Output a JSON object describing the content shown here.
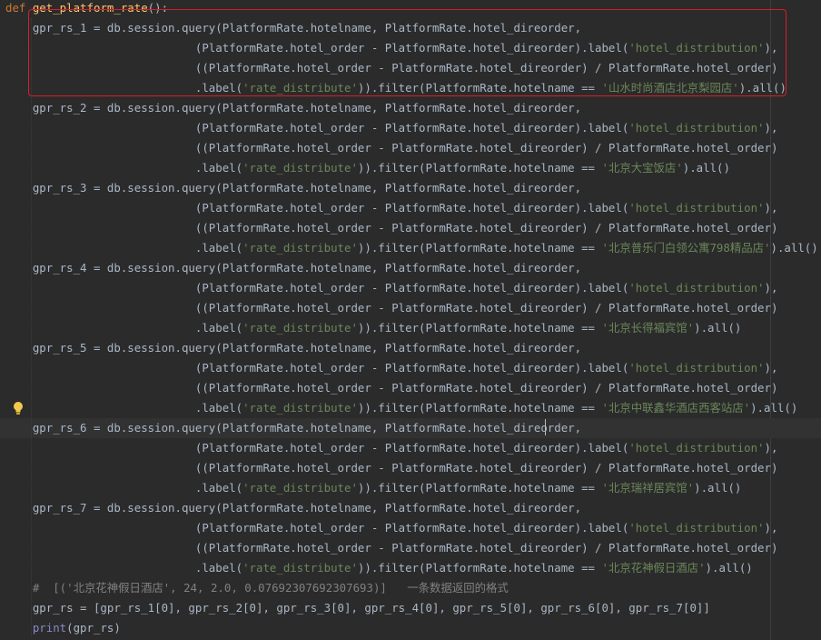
{
  "colors": {
    "background": "#2b2b2b",
    "text": "#a9b7c6",
    "keyword": "#cc7832",
    "function_name": "#ffc66d",
    "string": "#6a8759",
    "comment": "#808080",
    "builtin": "#8888c6",
    "annotation_box": "#d81e27",
    "bulb": "#f2c94c"
  },
  "icons": {
    "bulb": "lightbulb-icon"
  },
  "lines": [
    [
      [
        "kw",
        "def "
      ],
      [
        "fn",
        "get_platform_rate"
      ],
      [
        "txt",
        "():"
      ]
    ],
    [
      [
        "txt",
        "    gpr_rs_1 = db.session.query(PlatformRate.hotelname, PlatformRate.hotel_direorder,"
      ]
    ],
    [
      [
        "txt",
        "                            (PlatformRate.hotel_order - PlatformRate.hotel_direorder).label("
      ],
      [
        "str",
        "'hotel_distribution'"
      ],
      [
        "txt",
        "),"
      ]
    ],
    [
      [
        "txt",
        "                            ((PlatformRate.hotel_order - PlatformRate.hotel_direorder) / PlatformRate.hotel_order)"
      ]
    ],
    [
      [
        "txt",
        "                            .label("
      ],
      [
        "str",
        "'rate_distribute'"
      ],
      [
        "txt",
        ")).filter(PlatformRate.hotelname == "
      ],
      [
        "str",
        "'山水时尚酒店北京梨园店'"
      ],
      [
        "txt",
        ").all()"
      ]
    ],
    [
      [
        "txt",
        "    gpr_rs_2 = db.session.query(PlatformRate.hotelname, PlatformRate.hotel_direorder,"
      ]
    ],
    [
      [
        "txt",
        "                            (PlatformRate.hotel_order - PlatformRate.hotel_direorder).label("
      ],
      [
        "str",
        "'hotel_distribution'"
      ],
      [
        "txt",
        "),"
      ]
    ],
    [
      [
        "txt",
        "                            ((PlatformRate.hotel_order - PlatformRate.hotel_direorder) / PlatformRate.hotel_order)"
      ]
    ],
    [
      [
        "txt",
        "                            .label("
      ],
      [
        "str",
        "'rate_distribute'"
      ],
      [
        "txt",
        ")).filter(PlatformRate.hotelname == "
      ],
      [
        "str",
        "'北京大宝饭店'"
      ],
      [
        "txt",
        ").all()"
      ]
    ],
    [
      [
        "txt",
        "    gpr_rs_3 = db.session.query(PlatformRate.hotelname, PlatformRate.hotel_direorder,"
      ]
    ],
    [
      [
        "txt",
        "                            (PlatformRate.hotel_order - PlatformRate.hotel_direorder).label("
      ],
      [
        "str",
        "'hotel_distribution'"
      ],
      [
        "txt",
        "),"
      ]
    ],
    [
      [
        "txt",
        "                            ((PlatformRate.hotel_order - PlatformRate.hotel_direorder) / PlatformRate.hotel_order)"
      ]
    ],
    [
      [
        "txt",
        "                            .label("
      ],
      [
        "str",
        "'rate_distribute'"
      ],
      [
        "txt",
        ")).filter(PlatformRate.hotelname == "
      ],
      [
        "str",
        "'北京普乐门白领公寓798精品店'"
      ],
      [
        "txt",
        ").all()"
      ]
    ],
    [
      [
        "txt",
        "    gpr_rs_4 = db.session.query(PlatformRate.hotelname, PlatformRate.hotel_direorder,"
      ]
    ],
    [
      [
        "txt",
        "                            (PlatformRate.hotel_order - PlatformRate.hotel_direorder).label("
      ],
      [
        "str",
        "'hotel_distribution'"
      ],
      [
        "txt",
        "),"
      ]
    ],
    [
      [
        "txt",
        "                            ((PlatformRate.hotel_order - PlatformRate.hotel_direorder) / PlatformRate.hotel_order)"
      ]
    ],
    [
      [
        "txt",
        "                            .label("
      ],
      [
        "str",
        "'rate_distribute'"
      ],
      [
        "txt",
        ")).filter(PlatformRate.hotelname == "
      ],
      [
        "str",
        "'北京长得福宾馆'"
      ],
      [
        "txt",
        ").all()"
      ]
    ],
    [
      [
        "txt",
        "    gpr_rs_5 = db.session.query(PlatformRate.hotelname, PlatformRate.hotel_direorder,"
      ]
    ],
    [
      [
        "txt",
        "                            (PlatformRate.hotel_order - PlatformRate.hotel_direorder).label("
      ],
      [
        "str",
        "'hotel_distribution'"
      ],
      [
        "txt",
        "),"
      ]
    ],
    [
      [
        "txt",
        "                            ((PlatformRate.hotel_order - PlatformRate.hotel_direorder) / PlatformRate.hotel_order)"
      ]
    ],
    [
      [
        "txt",
        "                            .label("
      ],
      [
        "str",
        "'rate_distribute'"
      ],
      [
        "txt",
        ")).filter(PlatformRate.hotelname == "
      ],
      [
        "str",
        "'北京中联鑫华酒店西客站店'"
      ],
      [
        "txt",
        ").all()"
      ]
    ],
    [
      [
        "txt",
        "    gpr_rs_6 = db.session.query(PlatformRate.hotelname, PlatformRate.hotel_direorder,"
      ]
    ],
    [
      [
        "txt",
        "                            (PlatformRate.hotel_order - PlatformRate.hotel_direorder).label("
      ],
      [
        "str",
        "'hotel_distribution'"
      ],
      [
        "txt",
        "),"
      ]
    ],
    [
      [
        "txt",
        "                            ((PlatformRate.hotel_order - PlatformRate.hotel_direorder) / PlatformRate.hotel_order)"
      ]
    ],
    [
      [
        "txt",
        "                            .label("
      ],
      [
        "str",
        "'rate_distribute'"
      ],
      [
        "txt",
        ")).filter(PlatformRate.hotelname == "
      ],
      [
        "str",
        "'北京瑞祥居宾馆'"
      ],
      [
        "txt",
        ").all()"
      ]
    ],
    [
      [
        "txt",
        "    gpr_rs_7 = db.session.query(PlatformRate.hotelname, PlatformRate.hotel_direorder,"
      ]
    ],
    [
      [
        "txt",
        "                            (PlatformRate.hotel_order - PlatformRate.hotel_direorder).label("
      ],
      [
        "str",
        "'hotel_distribution'"
      ],
      [
        "txt",
        "),"
      ]
    ],
    [
      [
        "txt",
        "                            ((PlatformRate.hotel_order - PlatformRate.hotel_direorder) / PlatformRate.hotel_order)"
      ]
    ],
    [
      [
        "txt",
        "                            .label("
      ],
      [
        "str",
        "'rate_distribute'"
      ],
      [
        "txt",
        ")).filter(PlatformRate.hotelname == "
      ],
      [
        "str",
        "'北京花神假日酒店'"
      ],
      [
        "txt",
        ").all()"
      ]
    ],
    [
      [
        "cm",
        "    #  [('北京花神假日酒店', 24, 2.0, 0.07692307692307693)]   一条数据返回的格式"
      ]
    ],
    [
      [
        "txt",
        "    gpr_rs = [gpr_rs_1[0], gpr_rs_2[0], gpr_rs_3[0], gpr_rs_4[0], gpr_rs_5[0], gpr_rs_6[0], gpr_rs_7[0]]"
      ]
    ],
    [
      [
        "bi",
        "    print"
      ],
      [
        "txt",
        "(gpr_rs)"
      ]
    ]
  ]
}
